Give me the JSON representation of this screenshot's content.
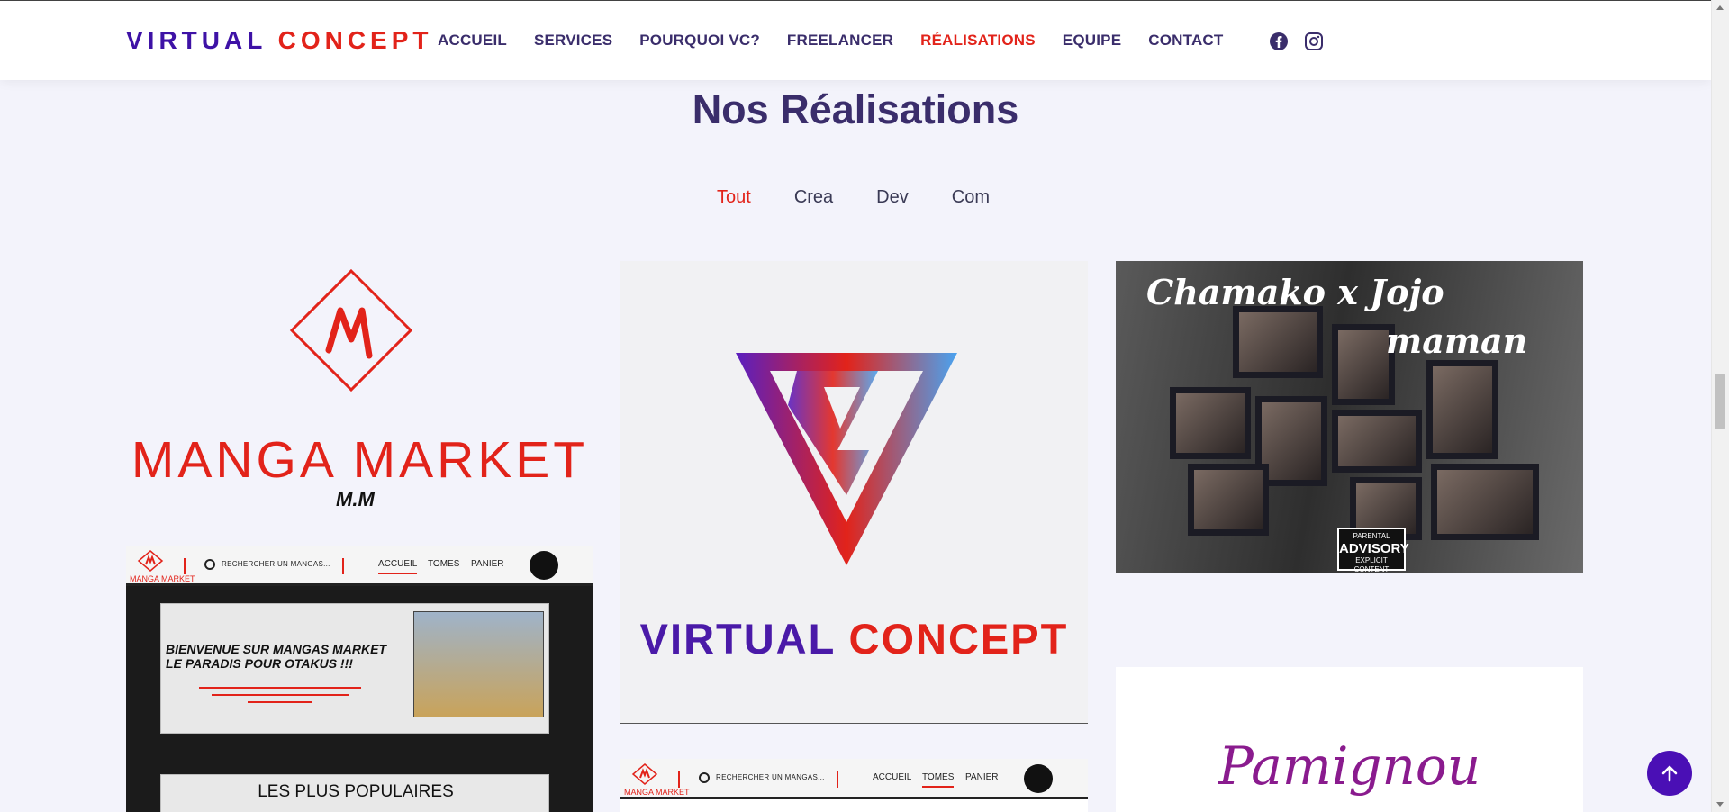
{
  "brand": {
    "part1": "VIRTUAL",
    "part2": "CONCEPT"
  },
  "nav": [
    {
      "label": "ACCUEIL",
      "active": false
    },
    {
      "label": "SERVICES",
      "active": false
    },
    {
      "label": "POURQUOI VC?",
      "active": false
    },
    {
      "label": "FREELANCER",
      "active": false
    },
    {
      "label": "RÉALISATIONS",
      "active": true
    },
    {
      "label": "EQUIPE",
      "active": false
    },
    {
      "label": "CONTACT",
      "active": false
    }
  ],
  "social": [
    "facebook-icon",
    "instagram-icon"
  ],
  "section": {
    "title": "Nos Réalisations"
  },
  "filters": [
    {
      "label": "Tout",
      "active": true
    },
    {
      "label": "Crea",
      "active": false
    },
    {
      "label": "Dev",
      "active": false
    },
    {
      "label": "Com",
      "active": false
    }
  ],
  "portfolio": {
    "manga_logo": {
      "title": "MANGA MARKET",
      "sub": "M.M"
    },
    "manga_site": {
      "logo_label": "MANGA MARKET",
      "search_placeholder": "RECHERCHER UN MANGAS...",
      "nav": [
        "ACCUEIL",
        "TOMES",
        "PANIER"
      ],
      "welcome_line1": "BIENVENUE SUR  MANGAS MARKET",
      "welcome_line2": "LE PARADIS POUR OTAKUS !!!",
      "popular": "LES PLUS POPULAIRES"
    },
    "vc_logo": {
      "part1": "VIRTUAL",
      "part2": "CONCEPT"
    },
    "chamako": {
      "title": "Chamako x Jojo",
      "subtitle": "maman",
      "badge_top": "PARENTAL",
      "badge_mid": "ADVISORY",
      "badge_bottom": "EXPLICIT CONTENT"
    },
    "pamignou": {
      "title": "Pamignou"
    }
  },
  "colors": {
    "primary": "#3e12a6",
    "accent": "#e2231a",
    "nav": "#3a2d6b",
    "background": "#f3f3fb"
  }
}
